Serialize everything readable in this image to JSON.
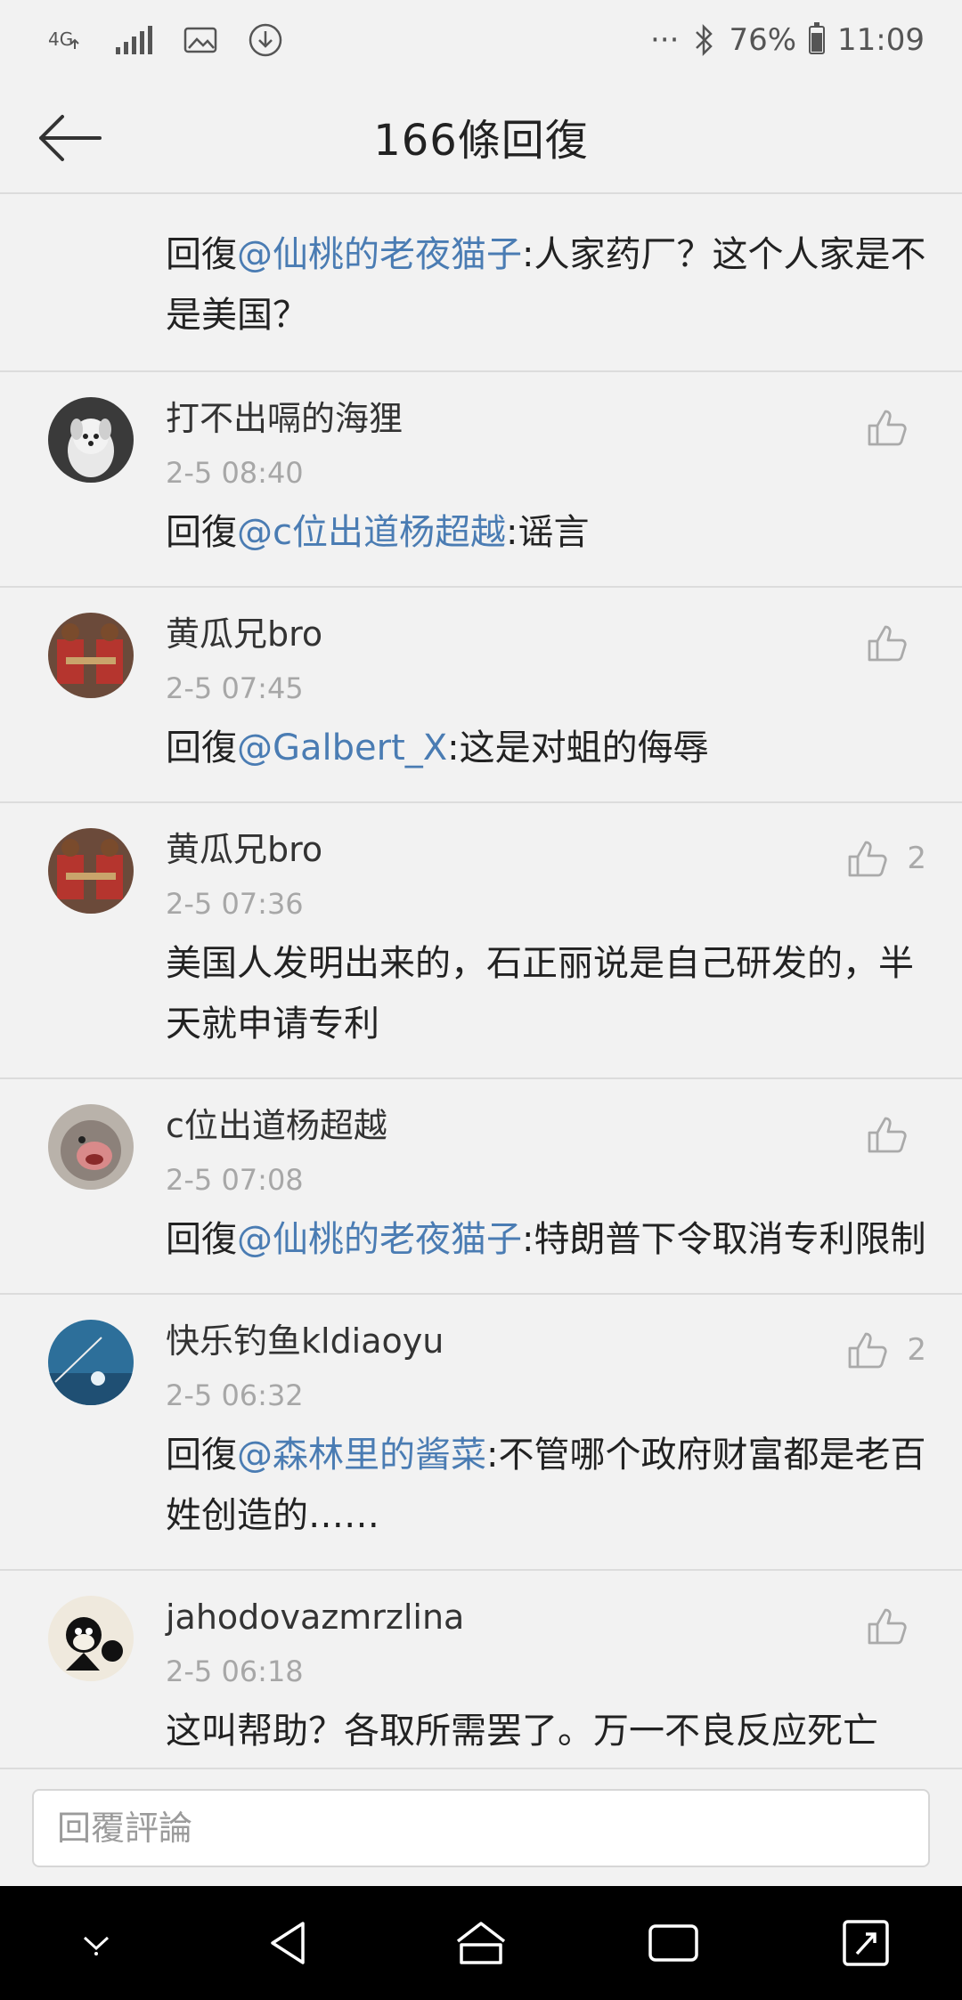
{
  "status_bar": {
    "network": "4G",
    "dots": "···",
    "battery": "76%",
    "time": "11:09"
  },
  "header": {
    "title": "166條回復"
  },
  "comments": [
    {
      "partial": true,
      "reply_prefix": "回復",
      "mention": "@仙桃的老夜猫子",
      "text": ":人家药厂？这个人家是不是美国？"
    },
    {
      "user": "打不出嗝的海狸",
      "time": "2-5 08:40",
      "reply_prefix": "回復",
      "mention": "@c位出道杨超越",
      "text": ":谣言",
      "likes": "",
      "avatar": "dog"
    },
    {
      "user": "黄瓜兄bro",
      "time": "2-5 07:45",
      "reply_prefix": "回復",
      "mention": "@Galbert_X",
      "text": ":这是对蛆的侮辱",
      "likes": "",
      "avatar": "basketball"
    },
    {
      "user": "黄瓜兄bro",
      "time": "2-5 07:36",
      "reply_prefix": "",
      "mention": "",
      "text": "美国人发明出来的，石正丽说是自己研发的，半天就申请专利",
      "likes": "2",
      "avatar": "basketball"
    },
    {
      "user": "c位出道杨超越",
      "time": "2-5 07:08",
      "reply_prefix": "回復",
      "mention": "@仙桃的老夜猫子",
      "text": ":特朗普下令取消专利限制",
      "likes": "",
      "avatar": "monkey"
    },
    {
      "user": "快乐钓鱼kldiaoyu",
      "time": "2-5 06:32",
      "reply_prefix": "回復",
      "mention": "@森林里的酱菜",
      "text": ":不管哪个政府财富都是老百姓创造的……",
      "likes": "2",
      "avatar": "fishing"
    },
    {
      "user": "jahodovazmrzlina",
      "time": "2-5 06:18",
      "reply_prefix": "",
      "mention": "",
      "text": "这叫帮助？各取所需罢了。万一不良反应死亡",
      "likes": "",
      "avatar": "cat"
    }
  ],
  "footer": {
    "placeholder": "回覆評論"
  },
  "icons": {
    "back": "arrow-left-icon",
    "like": "thumbs-up-icon",
    "nav": [
      "chevron-down-icon",
      "back-triangle-icon",
      "home-icon",
      "recents-icon",
      "expand-icon"
    ]
  }
}
